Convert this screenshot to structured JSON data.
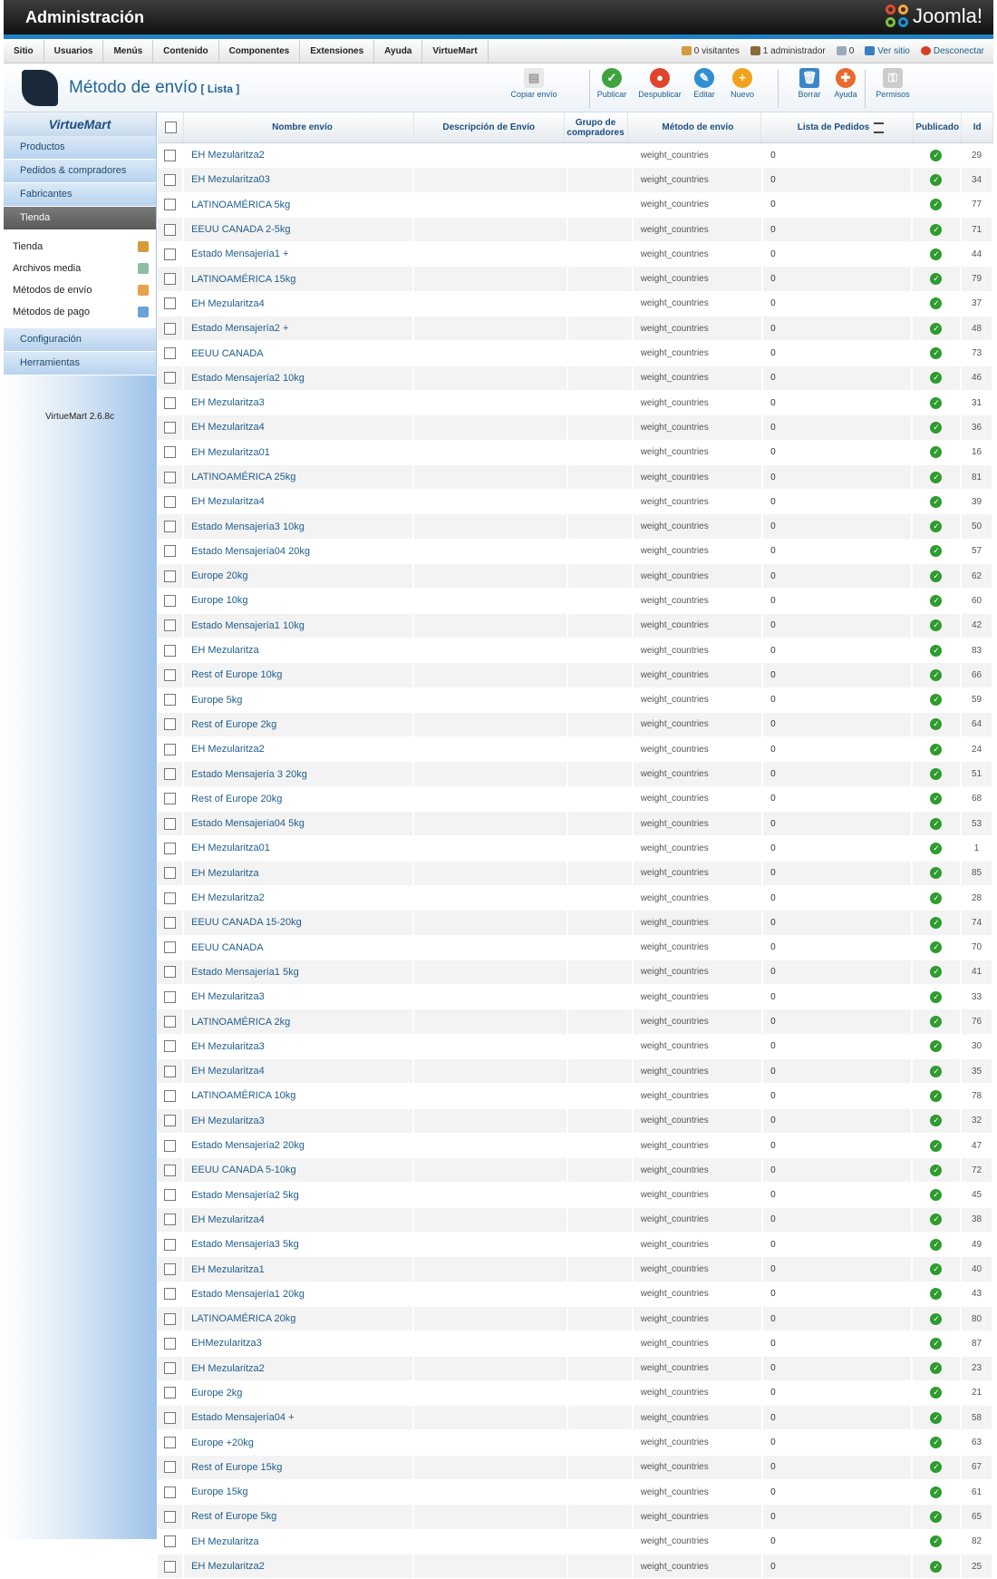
{
  "header": {
    "title": "Administración",
    "brand": "Joomla!"
  },
  "menu": [
    "Sitio",
    "Usuarios",
    "Menús",
    "Contenido",
    "Componentes",
    "Extensiones",
    "Ayuda",
    "VirtueMart"
  ],
  "status": {
    "visitors": "0 visitantes",
    "admins": "1 administrador",
    "messages": "0",
    "view_site": "Ver sitio",
    "logout": "Desconectar"
  },
  "page": {
    "title": "Método de envío",
    "subtitle": "[ Lista ]"
  },
  "toolbar": {
    "copy": "Copiar envío",
    "publish": "Publicar",
    "unpublish": "Despublicar",
    "edit": "Editar",
    "new": "Nuevo",
    "delete": "Borrar",
    "help": "Ayuda",
    "permissions": "Permisos"
  },
  "sidebar": {
    "logo": "VirtueMart",
    "nav": [
      "Productos",
      "Pedidos & compradores",
      "Fabricantes",
      "Tienda"
    ],
    "sub": [
      "Tienda",
      "Archivos media",
      "Métodos de envío",
      "Métodos de pago"
    ],
    "nav2": [
      "Configuración",
      "Herramientas"
    ],
    "version": "VirtueMart 2.6.8c"
  },
  "table": {
    "headers": {
      "name": "Nombre envío",
      "desc": "Descripción de Envío",
      "group": "Grupo de compradores",
      "method": "Método de envío",
      "order": "Lista de Pedidos",
      "published": "Publicado",
      "id": "Id"
    },
    "method": "weight_countries",
    "order": "0",
    "rows": [
      [
        "EH Mezularitza2",
        "29"
      ],
      [
        "EH Mezularitza03",
        "34"
      ],
      [
        "LATINOAMÉRICA 5kg",
        "77"
      ],
      [
        "EEUU CANADA 2-5kg",
        "71"
      ],
      [
        "Estado Mensajería1 +",
        "44"
      ],
      [
        "LATINOAMÉRICA 15kg",
        "79"
      ],
      [
        "EH Mezularitza4",
        "37"
      ],
      [
        "Estado Mensajería2 +",
        "48"
      ],
      [
        "EEUU CANADA",
        "73"
      ],
      [
        "Estado Mensajería2 10kg",
        "46"
      ],
      [
        "EH Mezularitza3",
        "31"
      ],
      [
        "EH Mezularitza4",
        "36"
      ],
      [
        "EH Mezularitza01",
        "16"
      ],
      [
        "LATINOAMÉRICA 25kg",
        "81"
      ],
      [
        "EH Mezularitza4",
        "39"
      ],
      [
        "Estado Mensajería3 10kg",
        "50"
      ],
      [
        "Estado Mensajería04 20kg",
        "57"
      ],
      [
        "Europe 20kg",
        "62"
      ],
      [
        "Europe 10kg",
        "60"
      ],
      [
        "Estado Mensajería1 10kg",
        "42"
      ],
      [
        "EH Mezularitza",
        "83"
      ],
      [
        "Rest of Europe 10kg",
        "66"
      ],
      [
        "Europe 5kg",
        "59"
      ],
      [
        "Rest of Europe 2kg",
        "64"
      ],
      [
        "EH Mezularitza2",
        "24"
      ],
      [
        "Estado Mensajería 3 20kg",
        "51"
      ],
      [
        "Rest of Europe 20kg",
        "68"
      ],
      [
        "Estado Mensajería04 5kg",
        "53"
      ],
      [
        "EH Mezularitza01",
        "1"
      ],
      [
        "EH Mezularitza",
        "85"
      ],
      [
        "EH Mezularitza2",
        "28"
      ],
      [
        "EEUU CANADA 15-20kg",
        "74"
      ],
      [
        "EEUU CANADA",
        "70"
      ],
      [
        "Estado Mensajería1 5kg",
        "41"
      ],
      [
        "EH Mezularitza3",
        "33"
      ],
      [
        "LATINOAMÉRICA 2kg",
        "76"
      ],
      [
        "EH Mezularitza3",
        "30"
      ],
      [
        "EH Mezularitza4",
        "35"
      ],
      [
        "LATINOAMÉRICA 10kg",
        "78"
      ],
      [
        "EH Mezularitza3",
        "32"
      ],
      [
        "Estado Mensajería2 20kg",
        "47"
      ],
      [
        "EEUU CANADA 5-10kg",
        "72"
      ],
      [
        "Estado Mensajería2 5kg",
        "45"
      ],
      [
        "EH Mezularitza4",
        "38"
      ],
      [
        "Estado Mensajería3 5kg",
        "49"
      ],
      [
        "EH Mezularitza1",
        "40"
      ],
      [
        "Estado Mensajería1 20kg",
        "43"
      ],
      [
        "LATINOAMÉRICA 20kg",
        "80"
      ],
      [
        "EHMezularitza3",
        "87"
      ],
      [
        "EH Mezularitza2",
        "23"
      ],
      [
        "Europe 2kg",
        "21"
      ],
      [
        "Estado Mensajería04 +",
        "58"
      ],
      [
        "Europe +20kg",
        "63"
      ],
      [
        "Rest of Europe 15kg",
        "67"
      ],
      [
        "Europe 15kg",
        "61"
      ],
      [
        "Rest of Europe 5kg",
        "65"
      ],
      [
        "EH Mezularitza",
        "82"
      ],
      [
        "EH Mezularitza2",
        "25"
      ]
    ]
  },
  "colors": {
    "accent": "#1f6496",
    "published": "#2e9b2e",
    "header": "#1f1f1f",
    "bluebar": "#1f7fc4"
  }
}
